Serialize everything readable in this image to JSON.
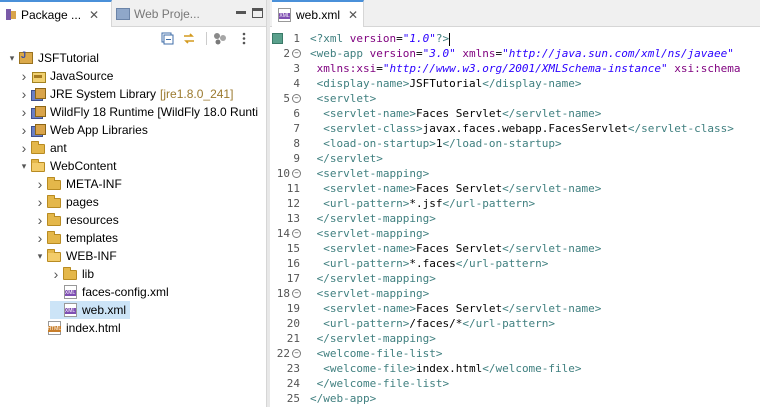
{
  "left_tabs": {
    "package_explorer": "Package ...",
    "web_project": "Web Proje..."
  },
  "tree": [
    {
      "label": "JSFTutorial",
      "icon": "project-icon",
      "arrow": "down",
      "indent": 0
    },
    {
      "label": "JavaSource",
      "icon": "source-folder-icon",
      "arrow": "right",
      "indent": 1
    },
    {
      "label": "JRE System Library",
      "decor": "[jre1.8.0_241]",
      "icon": "library-icon",
      "arrow": "right",
      "indent": 1
    },
    {
      "label": "WildFly 18 Runtime [WildFly 18.0 Runti",
      "icon": "library-icon",
      "arrow": "right",
      "indent": 1
    },
    {
      "label": "Web App Libraries",
      "icon": "library-icon",
      "arrow": "right",
      "indent": 1
    },
    {
      "label": "ant",
      "icon": "folder-icon",
      "arrow": "right",
      "indent": 1
    },
    {
      "label": "WebContent",
      "icon": "folder-open-icon",
      "arrow": "down",
      "indent": 1
    },
    {
      "label": "META-INF",
      "icon": "folder-icon",
      "arrow": "right",
      "indent": 2
    },
    {
      "label": "pages",
      "icon": "folder-icon",
      "arrow": "right",
      "indent": 2
    },
    {
      "label": "resources",
      "icon": "folder-icon",
      "arrow": "right",
      "indent": 2
    },
    {
      "label": "templates",
      "icon": "folder-icon",
      "arrow": "right",
      "indent": 2
    },
    {
      "label": "WEB-INF",
      "icon": "folder-open-icon",
      "arrow": "down",
      "indent": 2
    },
    {
      "label": "lib",
      "icon": "folder-icon",
      "arrow": "right",
      "indent": 3
    },
    {
      "label": "faces-config.xml",
      "icon": "xml-file-icon",
      "arrow": "",
      "indent": 3
    },
    {
      "label": "web.xml",
      "icon": "xml-file-icon",
      "arrow": "",
      "indent": 3,
      "selected": true
    },
    {
      "label": "index.html",
      "icon": "html-file-icon",
      "arrow": "",
      "indent": 2
    }
  ],
  "editor": {
    "tab_label": "web.xml",
    "lines": [
      {
        "n": "1",
        "fold": "",
        "seg": [
          [
            "pi",
            "<?xml "
          ],
          [
            "attr",
            "version"
          ],
          [
            "txt",
            "="
          ],
          [
            "val",
            "\"1.0\""
          ],
          [
            "pi",
            "?>"
          ]
        ]
      },
      {
        "n": "2",
        "fold": "-",
        "seg": [
          [
            "tag",
            "<web-app "
          ],
          [
            "attr",
            "version"
          ],
          [
            "txt",
            "="
          ],
          [
            "val",
            "\"3.0\""
          ],
          [
            "txt",
            " "
          ],
          [
            "attr",
            "xmlns"
          ],
          [
            "txt",
            "="
          ],
          [
            "val",
            "\"http://java.sun.com/xml/ns/javaee\""
          ]
        ]
      },
      {
        "n": "3",
        "fold": "",
        "seg": [
          [
            "txt",
            " "
          ],
          [
            "attr",
            "xmlns:xsi"
          ],
          [
            "txt",
            "="
          ],
          [
            "val",
            "\"http://www.w3.org/2001/XMLSchema-instance\""
          ],
          [
            "txt",
            " "
          ],
          [
            "attr",
            "xsi:schema"
          ]
        ]
      },
      {
        "n": "4",
        "fold": "",
        "seg": [
          [
            "tag",
            " <display-name>"
          ],
          [
            "txt",
            "JSFTutorial"
          ],
          [
            "tag",
            "</display-name>"
          ]
        ]
      },
      {
        "n": "5",
        "fold": "-",
        "seg": [
          [
            "tag",
            " <servlet>"
          ]
        ]
      },
      {
        "n": "6",
        "fold": "",
        "seg": [
          [
            "tag",
            "  <servlet-name>"
          ],
          [
            "txt",
            "Faces Servlet"
          ],
          [
            "tag",
            "</servlet-name>"
          ]
        ]
      },
      {
        "n": "7",
        "fold": "",
        "seg": [
          [
            "tag",
            "  <servlet-class>"
          ],
          [
            "txt",
            "javax.faces.webapp.FacesServlet"
          ],
          [
            "tag",
            "</servlet-class>"
          ]
        ]
      },
      {
        "n": "8",
        "fold": "",
        "seg": [
          [
            "tag",
            "  <load-on-startup>"
          ],
          [
            "txt",
            "1"
          ],
          [
            "tag",
            "</load-on-startup>"
          ]
        ]
      },
      {
        "n": "9",
        "fold": "",
        "seg": [
          [
            "tag",
            " </servlet>"
          ]
        ]
      },
      {
        "n": "10",
        "fold": "-",
        "seg": [
          [
            "tag",
            " <servlet-mapping>"
          ]
        ]
      },
      {
        "n": "11",
        "fold": "",
        "seg": [
          [
            "tag",
            "  <servlet-name>"
          ],
          [
            "txt",
            "Faces Servlet"
          ],
          [
            "tag",
            "</servlet-name>"
          ]
        ]
      },
      {
        "n": "12",
        "fold": "",
        "seg": [
          [
            "tag",
            "  <url-pattern>"
          ],
          [
            "txt",
            "*.jsf"
          ],
          [
            "tag",
            "</url-pattern>"
          ]
        ]
      },
      {
        "n": "13",
        "fold": "",
        "seg": [
          [
            "tag",
            " </servlet-mapping>"
          ]
        ]
      },
      {
        "n": "14",
        "fold": "-",
        "seg": [
          [
            "tag",
            " <servlet-mapping>"
          ]
        ]
      },
      {
        "n": "15",
        "fold": "",
        "seg": [
          [
            "tag",
            "  <servlet-name>"
          ],
          [
            "txt",
            "Faces Servlet"
          ],
          [
            "tag",
            "</servlet-name>"
          ]
        ]
      },
      {
        "n": "16",
        "fold": "",
        "seg": [
          [
            "tag",
            "  <url-pattern>"
          ],
          [
            "txt",
            "*.faces"
          ],
          [
            "tag",
            "</url-pattern>"
          ]
        ]
      },
      {
        "n": "17",
        "fold": "",
        "seg": [
          [
            "tag",
            " </servlet-mapping>"
          ]
        ]
      },
      {
        "n": "18",
        "fold": "-",
        "seg": [
          [
            "tag",
            " <servlet-mapping>"
          ]
        ]
      },
      {
        "n": "19",
        "fold": "",
        "seg": [
          [
            "tag",
            "  <servlet-name>"
          ],
          [
            "txt",
            "Faces Servlet"
          ],
          [
            "tag",
            "</servlet-name>"
          ]
        ]
      },
      {
        "n": "20",
        "fold": "",
        "seg": [
          [
            "tag",
            "  <url-pattern>"
          ],
          [
            "txt",
            "/faces/*"
          ],
          [
            "tag",
            "</url-pattern>"
          ]
        ]
      },
      {
        "n": "21",
        "fold": "",
        "seg": [
          [
            "tag",
            " </servlet-mapping>"
          ]
        ]
      },
      {
        "n": "22",
        "fold": "-",
        "seg": [
          [
            "tag",
            " <welcome-file-list>"
          ]
        ]
      },
      {
        "n": "23",
        "fold": "",
        "seg": [
          [
            "tag",
            "  <welcome-file>"
          ],
          [
            "txt",
            "index.html"
          ],
          [
            "tag",
            "</welcome-file>"
          ]
        ]
      },
      {
        "n": "24",
        "fold": "",
        "seg": [
          [
            "tag",
            " </welcome-file-list>"
          ]
        ]
      },
      {
        "n": "25",
        "fold": "",
        "seg": [
          [
            "tag",
            "</web-app>"
          ]
        ]
      }
    ]
  },
  "colors": {
    "tag": "#3f7f7f",
    "attr": "#7f007f",
    "value": "#2a00ff",
    "selection": "#cce4f7"
  }
}
